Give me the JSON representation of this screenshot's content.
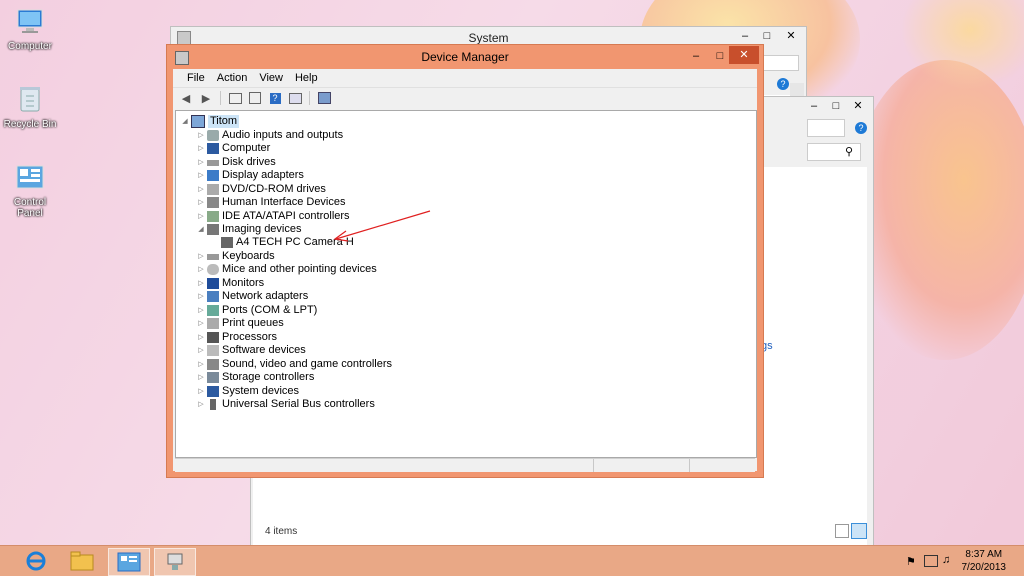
{
  "desktop": {
    "icons": [
      {
        "label": "Computer"
      },
      {
        "label": "Recycle Bin"
      },
      {
        "label": "Control Panel"
      }
    ]
  },
  "system_window": {
    "title": "System"
  },
  "control_panel_window": {
    "items_count": "4 items",
    "link_fragment": "gs"
  },
  "device_manager": {
    "title": "Device Manager",
    "menu": [
      "File",
      "Action",
      "View",
      "Help"
    ],
    "tree": {
      "root": "Titom",
      "categories": [
        "Audio inputs and outputs",
        "Computer",
        "Disk drives",
        "Display adapters",
        "DVD/CD-ROM drives",
        "Human Interface Devices",
        "IDE ATA/ATAPI controllers",
        "Imaging devices",
        "A4 TECH PC Camera H",
        "Keyboards",
        "Mice and other pointing devices",
        "Monitors",
        "Network adapters",
        "Ports (COM & LPT)",
        "Print queues",
        "Processors",
        "Software devices",
        "Sound, video and game controllers",
        "Storage controllers",
        "System devices",
        "Universal Serial Bus controllers"
      ]
    }
  },
  "taskbar": {
    "time": "8:37 AM",
    "date": "7/20/2013"
  },
  "colors": {
    "accent": "#f19670",
    "taskbar": "#e9a886",
    "annotation_arrow": "#e02020"
  }
}
